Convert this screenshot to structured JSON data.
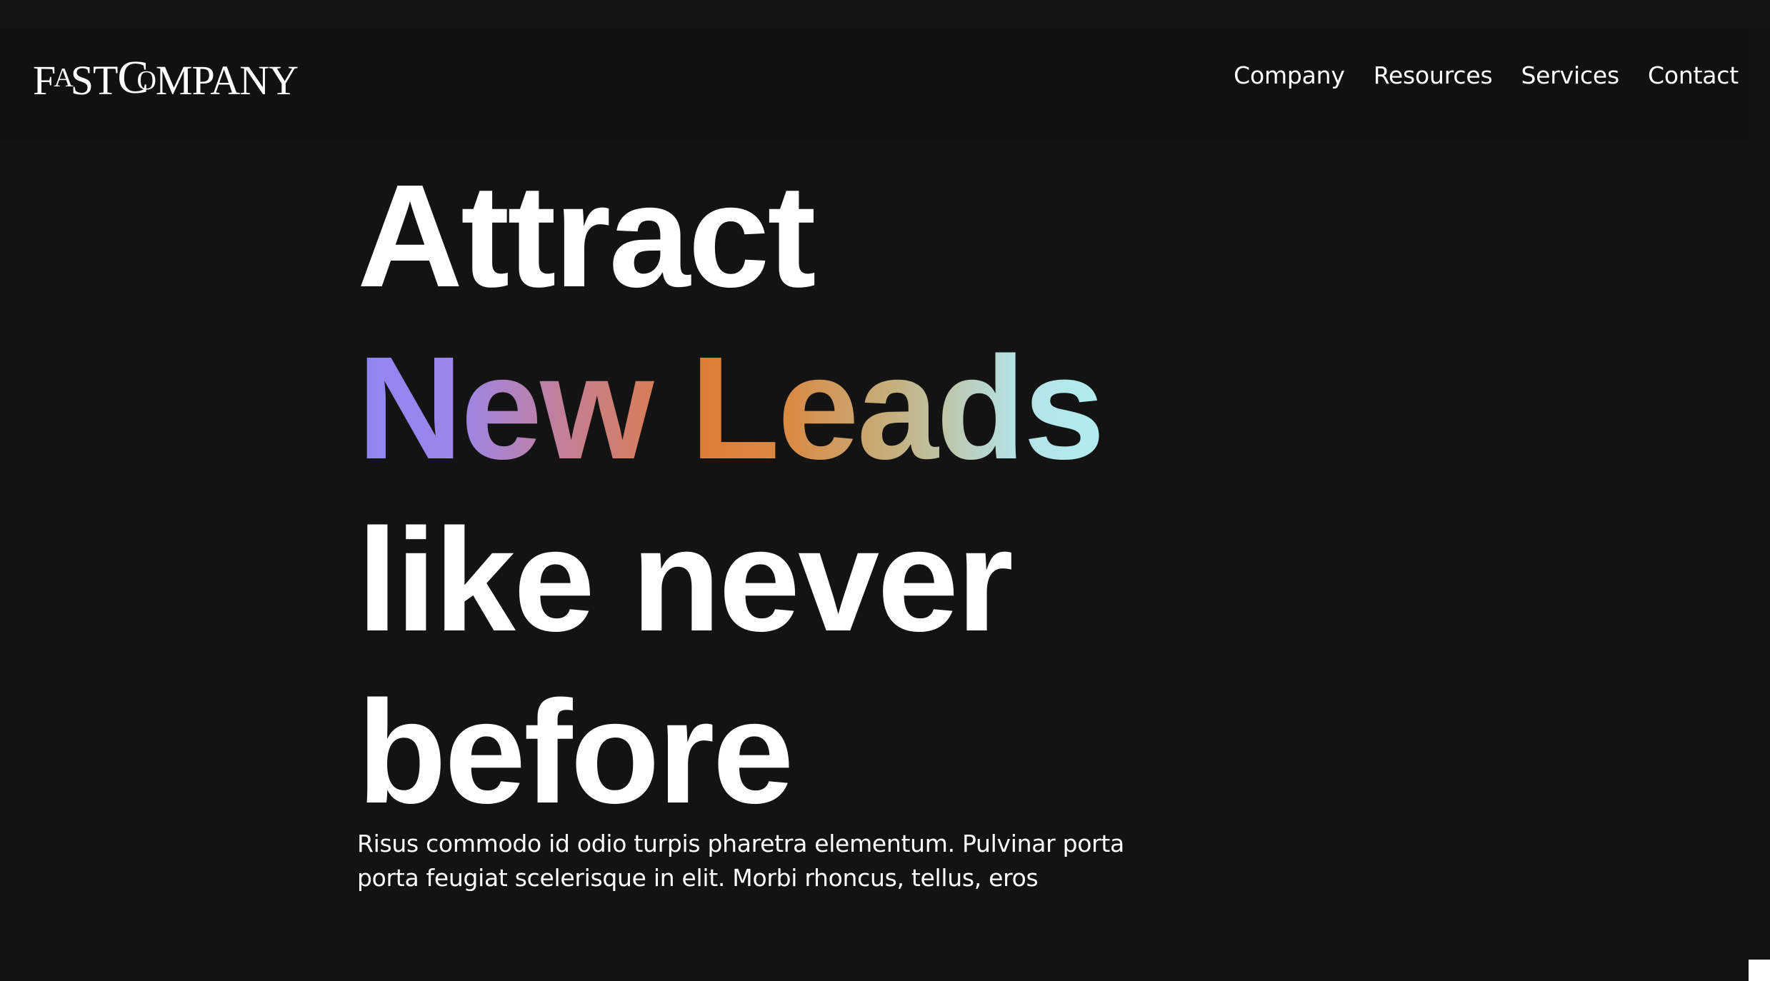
{
  "header": {
    "logo_text": "FAST COMPANY",
    "nav": [
      {
        "label": "Company"
      },
      {
        "label": "Resources"
      },
      {
        "label": "Services"
      },
      {
        "label": "Contact"
      }
    ]
  },
  "hero": {
    "line1": "Attract",
    "line2": "New Leads",
    "line3": "like never",
    "line4": "before",
    "subtitle": "Risus commodo id odio turpis pharetra elementum. Pulvinar porta porta feugiat scelerisque in elit. Morbi rhoncus, tellus, eros"
  },
  "colors": {
    "background": "#131313",
    "header_background": "#111111",
    "text": "#ffffff",
    "gradient": [
      "#8f86f2",
      "#c47f96",
      "#e07c35",
      "#c4b07e",
      "#b2ecf0"
    ]
  }
}
